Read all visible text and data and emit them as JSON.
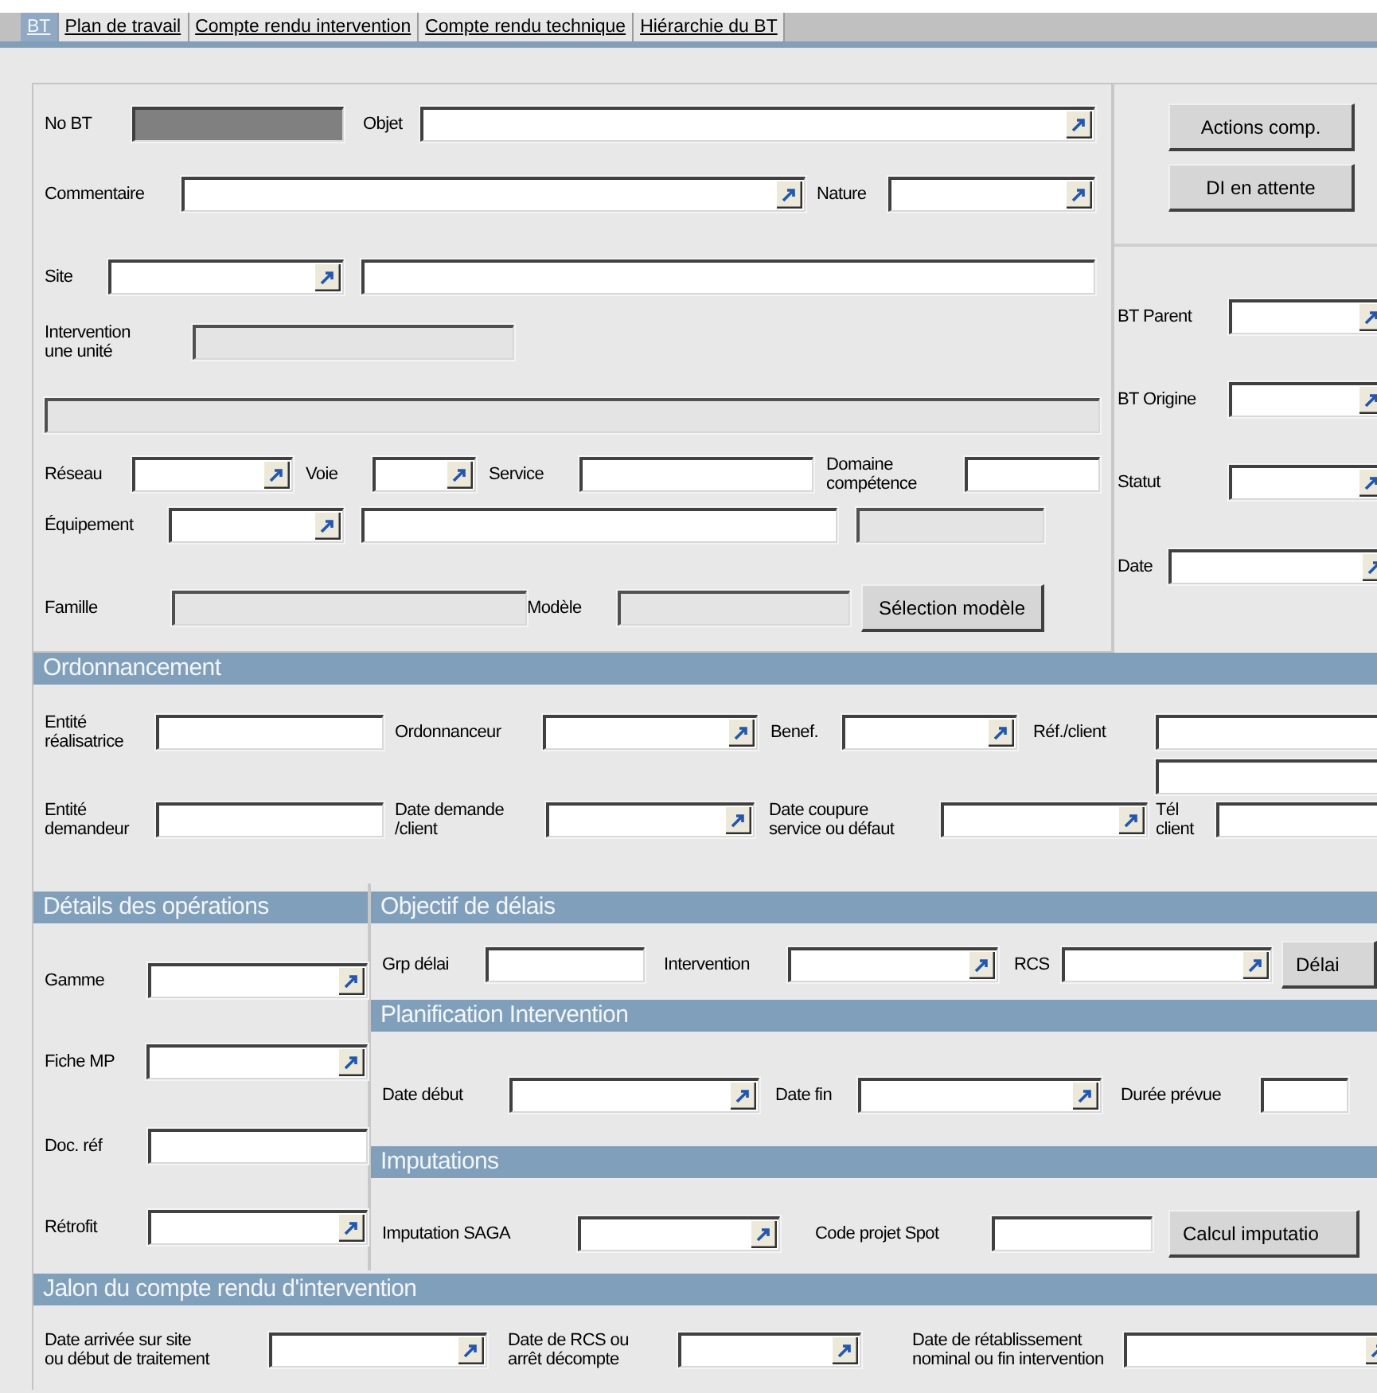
{
  "tabs": [
    {
      "label": "BT",
      "selected": true
    },
    {
      "label": "Plan de travail",
      "selected": false
    },
    {
      "label": "Compte rendu intervention",
      "selected": false
    },
    {
      "label": "Compte rendu technique",
      "selected": false
    },
    {
      "label": "Hiérarchie du BT",
      "selected": false
    }
  ],
  "main": {
    "lines": [
      [
        {
          "label": "No BT",
          "kind": "locked"
        },
        {
          "label": "Objet",
          "kind": "lookup"
        }
      ],
      [
        {
          "label": "Commentaire",
          "kind": "lookup"
        },
        {
          "label": "Nature",
          "kind": "lookup"
        }
      ],
      [
        {
          "label": "Site",
          "kind": "lookup"
        },
        {
          "kind": "input"
        }
      ],
      [
        {
          "label": "Intervention\nune unité",
          "kind": "readonly"
        }
      ],
      [
        {
          "kind": "readonly"
        }
      ],
      [
        {
          "label": "Réseau",
          "kind": "lookup"
        },
        {
          "label": "Voie",
          "kind": "lookup"
        },
        {
          "label": "Service",
          "kind": "input"
        },
        {
          "label": "Domaine\ncompétence",
          "kind": "input"
        }
      ],
      [
        {
          "label": "Équipement",
          "kind": "lookup"
        },
        {
          "kind": "input"
        },
        {
          "kind": "readonly"
        }
      ],
      [
        {
          "label": "Famille",
          "kind": "readonly"
        },
        {
          "label": "Modèle",
          "kind": "readonly"
        },
        {
          "kind": "button",
          "text": "Sélection modèle"
        }
      ]
    ]
  },
  "actions": {
    "lines": [
      [
        {
          "kind": "button",
          "text": "Actions comp."
        }
      ],
      [
        {
          "kind": "button",
          "text": "DI en attente"
        }
      ]
    ]
  },
  "related": {
    "lines": [
      [
        {
          "label": "BT Parent",
          "kind": "lookup"
        }
      ],
      [
        {
          "label": "BT Origine",
          "kind": "lookup"
        }
      ],
      [
        {
          "label": "Statut",
          "kind": "lookup"
        }
      ],
      [
        {
          "label": "Date",
          "kind": "lookup"
        }
      ]
    ]
  },
  "ordonnancement": {
    "title": "Ordonnancement",
    "lines": [
      [
        {
          "label": "Entité\nréalisatrice",
          "kind": "input"
        },
        {
          "label": "Ordonnanceur",
          "kind": "lookup"
        },
        {
          "label": "Benef.",
          "kind": "lookup"
        },
        {
          "label": "Réf./client",
          "kind": "input"
        }
      ],
      [
        {
          "kind": "input"
        }
      ],
      [
        {
          "label": "Entité\ndemandeur",
          "kind": "input"
        },
        {
          "label": "Date demande\n/client",
          "kind": "lookup"
        },
        {
          "label": "Date coupure\nservice ou défaut",
          "kind": "lookup"
        },
        {
          "label": "Tél\nclient",
          "kind": "input"
        }
      ]
    ]
  },
  "details_operations": {
    "title": "Détails des opérations",
    "lines": [
      [
        {
          "label": "Gamme",
          "kind": "lookup"
        }
      ],
      [
        {
          "label": "Fiche MP",
          "kind": "lookup"
        }
      ],
      [
        {
          "label": "Doc. réf",
          "kind": "input"
        }
      ],
      [
        {
          "label": "Rétrofit",
          "kind": "lookup"
        }
      ]
    ]
  },
  "objectif_delais": {
    "title": "Objectif de délais",
    "lines": [
      [
        {
          "label": "Grp délai",
          "kind": "input"
        },
        {
          "label": "Intervention",
          "kind": "lookup"
        },
        {
          "label": "RCS",
          "kind": "lookup"
        },
        {
          "kind": "button",
          "text": "Délai"
        }
      ]
    ]
  },
  "planification_intervention": {
    "title": "Planification Intervention",
    "lines": [
      [
        {
          "label": "Date début",
          "kind": "lookup"
        },
        {
          "label": "Date fin",
          "kind": "lookup"
        },
        {
          "label": "Durée prévue",
          "kind": "input"
        }
      ]
    ]
  },
  "imputations": {
    "title": "Imputations",
    "lines": [
      [
        {
          "label": "Imputation SAGA",
          "kind": "lookup"
        },
        {
          "label": "Code projet Spot",
          "kind": "input"
        },
        {
          "kind": "button",
          "text": "Calcul imputatio"
        }
      ]
    ]
  },
  "jalon": {
    "title": "Jalon du compte rendu d'intervention",
    "lines": [
      [
        {
          "label": "Date arrivée sur site\nou début de traitement",
          "kind": "lookup"
        },
        {
          "label": "Date de RCS ou\narrêt décompte",
          "kind": "lookup"
        },
        {
          "label": "Date de rétablissement\nnominal ou fin intervention",
          "kind": "lookup"
        }
      ]
    ]
  }
}
